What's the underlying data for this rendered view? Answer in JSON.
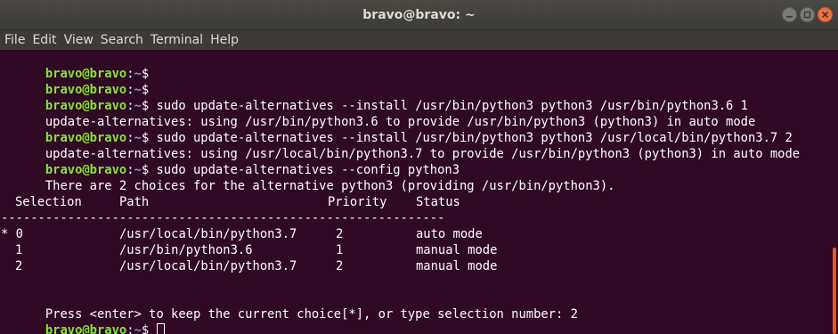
{
  "window": {
    "title": "bravo@bravo: ~"
  },
  "menu": [
    "File",
    "Edit",
    "View",
    "Search",
    "Terminal",
    "Help"
  ],
  "prompt": {
    "user_host": "bravo@bravo",
    "separator": ":",
    "path": "~",
    "dollar": "$"
  },
  "terminal": {
    "cmd1": " sudo update-alternatives --install /usr/bin/python3 python3 /usr/bin/python3.6 1",
    "out1": "update-alternatives: using /usr/bin/python3.6 to provide /usr/bin/python3 (python3) in auto mode",
    "cmd2": " sudo update-alternatives --install /usr/bin/python3 python3 /usr/local/bin/python3.7 2",
    "out2": "update-alternatives: using /usr/local/bin/python3.7 to provide /usr/bin/python3 (python3) in auto mode",
    "cmd3": " sudo update-alternatives --config python3",
    "out3": "There are 2 choices for the alternative python3 (providing /usr/bin/python3).",
    "table": {
      "headers": [
        "Selection",
        "Path",
        "Priority",
        "Status"
      ],
      "separator": "------------------------------------------------------------",
      "rows": [
        [
          "* 0",
          "/usr/local/bin/python3.7",
          "2",
          "auto mode"
        ],
        [
          "1",
          "/usr/bin/python3.6",
          "1",
          "manual mode"
        ],
        [
          "2",
          "/usr/local/bin/python3.7",
          "2",
          "manual mode"
        ]
      ]
    },
    "press_line": "Press <enter> to keep the current choice[*], or type selection number: 2"
  },
  "colors": {
    "background": "#300a24",
    "prompt_user": "#8ae234",
    "prompt_path": "#729fcf",
    "close_button": "#f0703f",
    "scrollbar_thumb": "#e95420"
  }
}
